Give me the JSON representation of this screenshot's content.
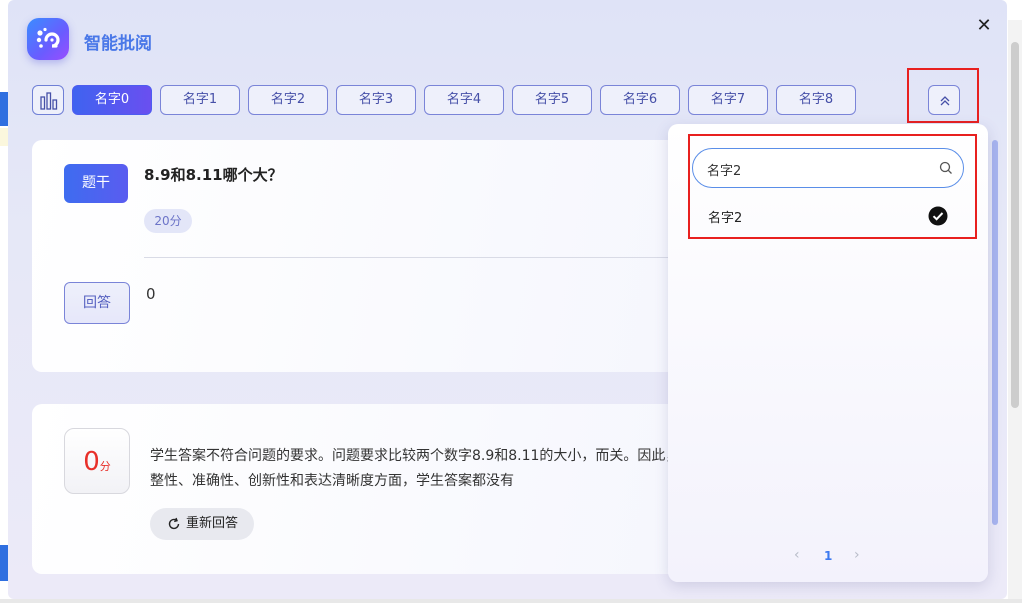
{
  "app": {
    "title": "智能批阅",
    "close_glyph": "✕"
  },
  "tabs": [
    {
      "label": "名字0",
      "active": true
    },
    {
      "label": "名字1",
      "active": false
    },
    {
      "label": "名字2",
      "active": false
    },
    {
      "label": "名字3",
      "active": false
    },
    {
      "label": "名字4",
      "active": false
    },
    {
      "label": "名字5",
      "active": false
    },
    {
      "label": "名字6",
      "active": false
    },
    {
      "label": "名字7",
      "active": false
    },
    {
      "label": "名字8",
      "active": false
    }
  ],
  "question_card": {
    "stem_label": "题干",
    "question": "8.9和8.11哪个大？",
    "score_tag": "20分",
    "answer_label": "回答",
    "answer": "0"
  },
  "result_card": {
    "score": "0",
    "score_unit": "分",
    "feedback": "学生答案不符合问题的要求。问题要求比较两个数字8.9和8.11的大小，而关。因此，在完整性、准确性、创新性和表达清晰度方面，学生答案都没有",
    "redo_label": "重新回答"
  },
  "dropdown": {
    "search_value": "名字2",
    "search_placeholder": "",
    "options": [
      {
        "label": "名字2",
        "selected": true
      }
    ],
    "pagination": {
      "prev": "‹",
      "current": "1",
      "next": "›"
    }
  },
  "colors": {
    "accent": "#4d5cf0",
    "highlight_box": "#e8201f",
    "score_red": "#e8302a"
  },
  "icons": [
    "logo-icon",
    "bar-chart-icon",
    "double-chevron-up-icon",
    "search-icon",
    "check-circle-icon",
    "refresh-icon",
    "close-icon"
  ]
}
